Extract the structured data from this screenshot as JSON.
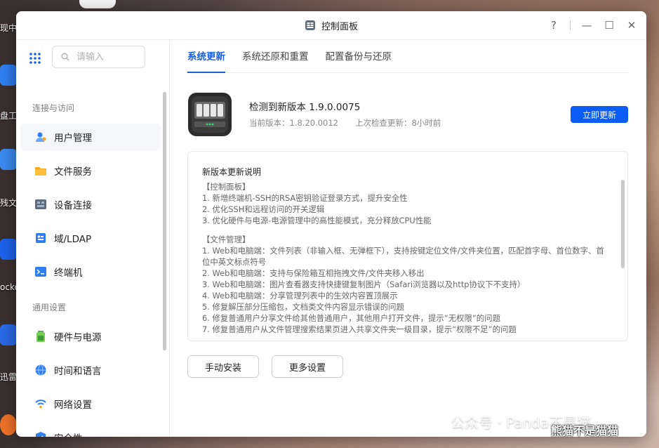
{
  "desktop": {
    "labels": [
      "现中",
      "盘工",
      "残文",
      "ocke",
      "迅雷"
    ]
  },
  "window": {
    "title": "控制面板",
    "controls": {
      "help": "?",
      "minimize": "—",
      "maximize": "☐",
      "close": "✕"
    }
  },
  "sidebar": {
    "search_placeholder": "请输入",
    "groups": [
      {
        "title": "连接与访问",
        "items": [
          "用户管理",
          "文件服务",
          "设备连接",
          "域/LDAP",
          "终端机"
        ]
      },
      {
        "title": "通用设置",
        "items": [
          "硬件与电源",
          "时间和语言",
          "网络设置",
          "安全性"
        ]
      }
    ]
  },
  "tabs": [
    "系统更新",
    "系统还原和重置",
    "配置备份与还原"
  ],
  "update": {
    "title": "检测到新版本 1.9.0.0075",
    "current_version": "当前版本：1.8.20.0012",
    "last_check": "上次检查更新：8小时前",
    "update_button": "立即更新"
  },
  "notes": {
    "title": "新版本更新说明",
    "lines": [
      "【控制面板】",
      "1. 新增终端机-SSH的RSA密钥验证登录方式，提升安全性",
      "2. 优化SSH和远程访问的开关逻辑",
      "3. 优化硬件与电源-电源管理中的高性能模式，充分释放CPU性能",
      "",
      "【文件管理】",
      "1. Web和电脑端：文件列表（非输入框、无弹框下），支持按键定位文件/文件夹位置，匹配首字母、首位数字、首位中英文标点符号",
      "2. Web和电脑端：支持与保险箱互相拖拽文件/文件夹移入移出",
      "3. Web和电脑端：图片查看器支持快捷键复制图片（Safari浏览器以及http协议下不支持）",
      "4. Web和电脑端：分享管理列表中的生效内容置顶展示",
      "5. 修复解压部分压缩包，文档类文件内容显示错误的问题",
      "6. 修复普通用户分享文件给其他普通用户，其他用户打开文件，提示“无权限”的问题",
      "7. 修复普通用户从文件管理搜索结果页进入共享文件夹一级目录，提示“权限不足”的问题"
    ]
  },
  "buttons": {
    "manual_install": "手动安装",
    "more_settings": "更多设置"
  },
  "watermark": {
    "text": "公众号 · Panda不是猫",
    "overlay": "熊猫不是猫猫"
  },
  "colors": {
    "accent": "#1a5fdc",
    "primary_button": "#0a5cf5"
  }
}
